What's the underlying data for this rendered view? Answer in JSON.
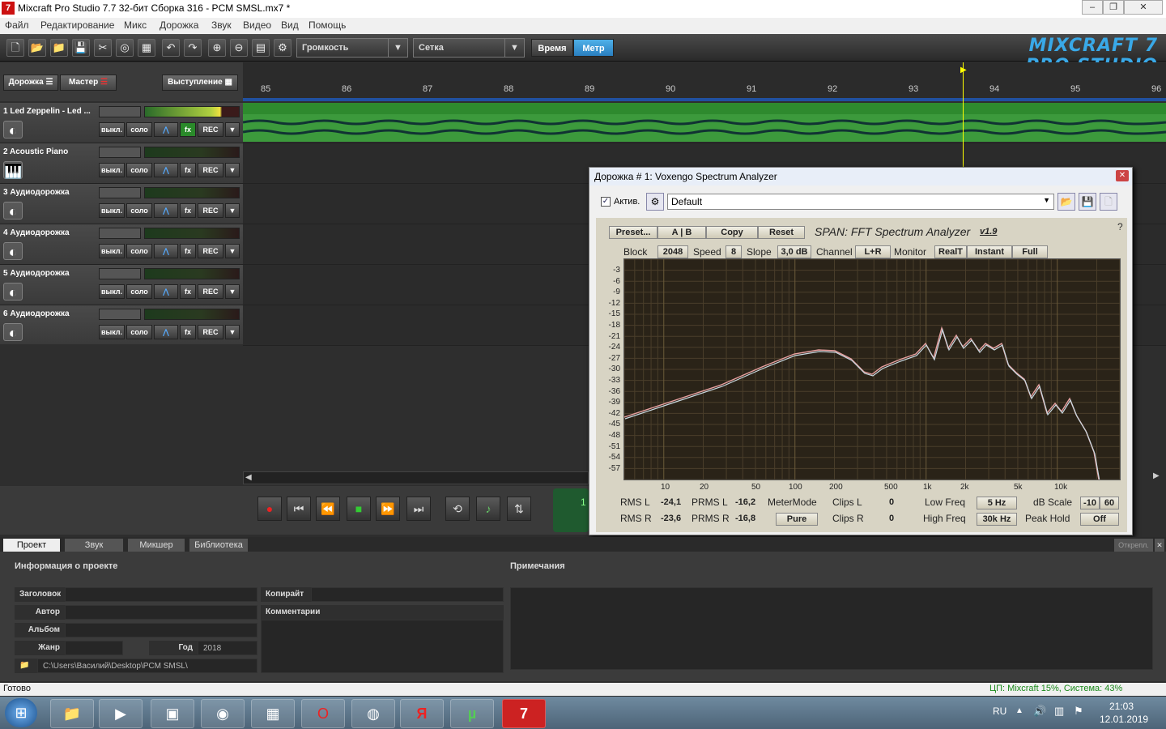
{
  "window": {
    "title": "Mixcraft Pro Studio 7.7 32-бит Сборка 316 - PCM SMSL.mx7 *",
    "app_icon": "7",
    "controls": [
      "minimize-icon",
      "maximize-icon",
      "close-icon"
    ]
  },
  "menu": [
    "Файл",
    "Редактирование",
    "Микс",
    "Дорожка",
    "Звук",
    "Видео",
    "Вид",
    "Помощь"
  ],
  "toolbar": {
    "view_select": "Громкость",
    "snap_select": "Сетка",
    "time_label": "Время",
    "beat_label": "Метр",
    "logo_text": "MIXCRAFT 7 PRO STUDIO"
  },
  "track_header": {
    "track_button": "Дорожка",
    "master_button": "Мастер",
    "performance_button": "Выступление"
  },
  "ruler": {
    "bars": [
      "85",
      "86",
      "87",
      "88",
      "89",
      "90",
      "91",
      "92",
      "93",
      "94",
      "95",
      "96"
    ]
  },
  "tracks": [
    {
      "name": "1 Led Zeppelin - Led ...",
      "icon": "audio-icon"
    },
    {
      "name": "2 Acoustic Piano",
      "icon": "piano-icon"
    },
    {
      "name": "3 Аудиодорожка",
      "icon": "audio-icon"
    },
    {
      "name": "4 Аудиодорожка",
      "icon": "audio-icon"
    },
    {
      "name": "5 Аудиодорожка",
      "icon": "audio-icon"
    },
    {
      "name": "6 Аудиодорожка",
      "icon": "audio-icon"
    }
  ],
  "track_buttons": {
    "mute": "выкл.",
    "solo": "соло",
    "fx": "fx",
    "rec": "REC"
  },
  "plugin": {
    "title": "Дорожка # 1: Voxengo Spectrum Analyzer",
    "active_label": "Актив.",
    "preset_value": "Default",
    "span": {
      "buttons_row1": [
        "Preset...",
        "A | B",
        "Copy",
        "Reset"
      ],
      "product_title": "SPAN: FFT Spectrum Analyzer",
      "version": "v1.9",
      "block_label": "Block",
      "block_value": "2048",
      "speed_label": "Speed",
      "speed_value": "8",
      "slope_label": "Slope",
      "slope_value": "3,0 dB",
      "channel_label": "Channel",
      "channel_value": "L+R",
      "monitor_label": "Monitor",
      "monitor_buttons": [
        "RealT",
        "Instant",
        "Full"
      ],
      "help": "?",
      "y_ticks": [
        "-3",
        "-6",
        "-9",
        "-12",
        "-15",
        "-18",
        "-21",
        "-24",
        "-27",
        "-30",
        "-33",
        "-36",
        "-39",
        "-42",
        "-45",
        "-48",
        "-51",
        "-54",
        "-57"
      ],
      "x_ticks": [
        "10",
        "20",
        "50",
        "100",
        "200",
        "500",
        "1k",
        "2k",
        "5k",
        "10k"
      ],
      "meters": {
        "rms_l_label": "RMS L",
        "rms_l": "-24,1",
        "rms_r_label": "RMS R",
        "rms_r": "-23,6",
        "prms_l_label": "PRMS L",
        "prms_l": "-16,2",
        "prms_r_label": "PRMS R",
        "prms_r": "-16,8",
        "meter_mode_label": "MeterMode",
        "meter_mode": "Pure",
        "clips_l_label": "Clips L",
        "clips_l": "0",
        "clips_r_label": "Clips R",
        "clips_r": "0",
        "low_freq_label": "Low Freq",
        "low_freq": "5 Hz",
        "high_freq_label": "High Freq",
        "high_freq": "30k Hz",
        "db_scale_label": "dB Scale",
        "db_scale_lo": "-10",
        "db_scale_hi": "60",
        "peak_hold_label": "Peak Hold",
        "peak_hold": "Off"
      }
    }
  },
  "transport_time": "1",
  "bottom_tabs": [
    "Проект",
    "Звук",
    "Микшер",
    "Библиотека"
  ],
  "undock": "Открепл.",
  "project": {
    "info_title": "Информация о проекте",
    "notes_title": "Примечания",
    "title_label": "Заголовок",
    "author_label": "Автор",
    "album_label": "Альбом",
    "genre_label": "Жанр",
    "year_label": "Год",
    "year_value": "2018",
    "copyright_label": "Копирайт",
    "comments_label": "Комментарии",
    "path": "C:\\Users\\Василий\\Desktop\\PCM SMSL\\"
  },
  "status": {
    "left": "Готово",
    "right": "ЦП: Mixcraft 15%, Система: 43%"
  },
  "taskbar": {
    "lang": "RU",
    "time": "21:03",
    "date": "12.01.2019"
  }
}
